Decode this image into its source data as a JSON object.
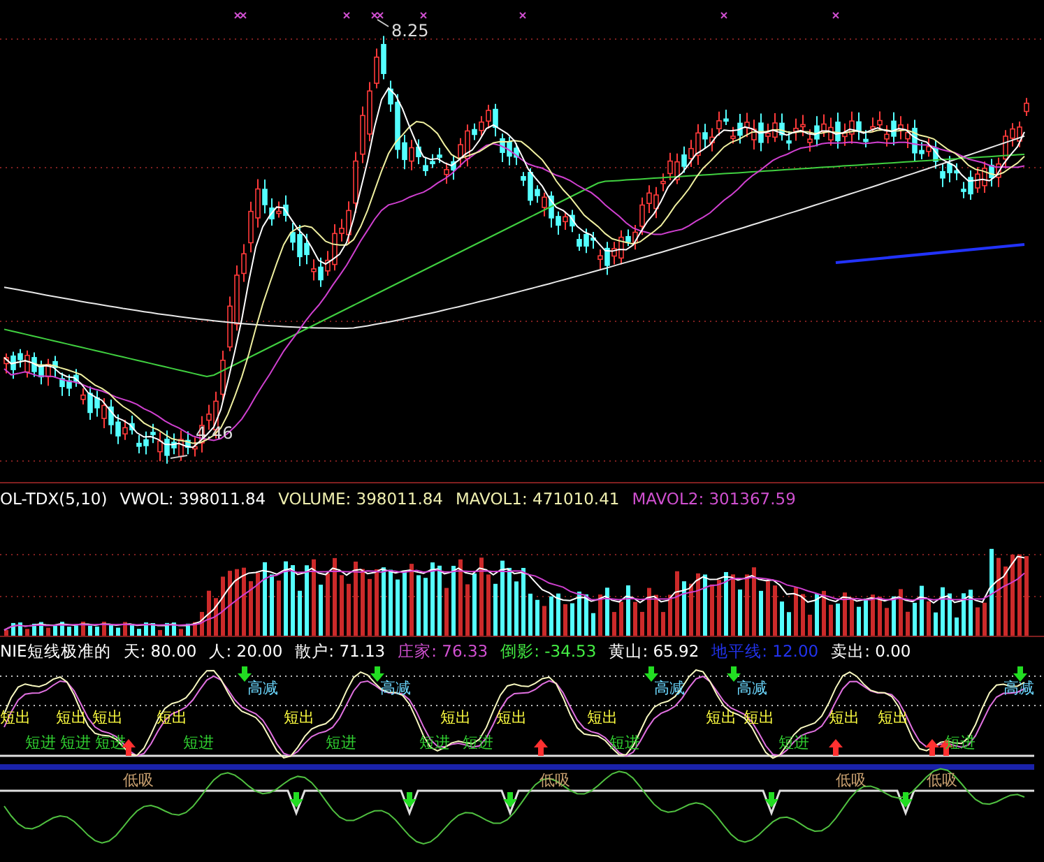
{
  "price_pane": {
    "high_label": "8.25",
    "low_label": "4.46"
  },
  "volume_pane": {
    "title": "OL-TDX(5,10)",
    "readings": [
      {
        "label": "VWOL: 398011.84",
        "color": "#ffffff"
      },
      {
        "label": "VOLUME: 398011.84",
        "color": "#f0f0b0"
      },
      {
        "label": "MAVOL1: 471010.41",
        "color": "#f0f0b0"
      },
      {
        "label": "MAVOL2: 301367.59",
        "color": "#d050d0"
      }
    ]
  },
  "indicator_pane": {
    "title": "NIE短线极准的",
    "readings": [
      {
        "label": "天: 80.00",
        "color": "#ffffff"
      },
      {
        "label": "人: 20.00",
        "color": "#ffffff"
      },
      {
        "label": "散户: 71.13",
        "color": "#ffffff"
      },
      {
        "label": "庄家: 76.33",
        "color": "#d050d0"
      },
      {
        "label": "倒影: -34.53",
        "color": "#44ee44"
      },
      {
        "label": "黄山: 65.92",
        "color": "#ffffff"
      },
      {
        "label": "地平线: 12.00",
        "color": "#2233ee"
      }
    ],
    "sell_reading": "卖出: 0.00",
    "signals": [
      {
        "text": "短出",
        "kind": "short-sell"
      },
      {
        "text": "短出",
        "kind": "short-sell"
      },
      {
        "text": "短出",
        "kind": "short-sell"
      },
      {
        "text": "短出",
        "kind": "short-sell"
      },
      {
        "text": "短出",
        "kind": "short-sell"
      },
      {
        "text": "短出",
        "kind": "short-sell"
      },
      {
        "text": "短出",
        "kind": "short-sell"
      },
      {
        "text": "短出",
        "kind": "short-sell"
      },
      {
        "text": "短出",
        "kind": "short-sell"
      },
      {
        "text": "短出",
        "kind": "short-sell"
      },
      {
        "text": "短出",
        "kind": "short-sell"
      },
      {
        "text": "短出",
        "kind": "short-sell"
      },
      {
        "text": "高减",
        "kind": "high-reduce"
      },
      {
        "text": "高减",
        "kind": "high-reduce"
      },
      {
        "text": "高减",
        "kind": "high-reduce"
      },
      {
        "text": "高减",
        "kind": "high-reduce"
      },
      {
        "text": "高减",
        "kind": "high-reduce"
      },
      {
        "text": "短进",
        "kind": "short-buy"
      },
      {
        "text": "短进",
        "kind": "short-buy"
      },
      {
        "text": "短进",
        "kind": "short-buy"
      },
      {
        "text": "短进",
        "kind": "short-buy"
      },
      {
        "text": "短进",
        "kind": "short-buy"
      },
      {
        "text": "短进",
        "kind": "short-buy"
      },
      {
        "text": "短进",
        "kind": "short-buy"
      },
      {
        "text": "短进",
        "kind": "short-buy"
      },
      {
        "text": "短进",
        "kind": "short-buy"
      },
      {
        "text": "短进",
        "kind": "short-buy"
      },
      {
        "text": "低吸",
        "kind": "low-buy"
      },
      {
        "text": "低吸",
        "kind": "low-buy"
      },
      {
        "text": "低吸",
        "kind": "low-buy"
      },
      {
        "text": "低吸",
        "kind": "low-buy"
      }
    ]
  }
}
